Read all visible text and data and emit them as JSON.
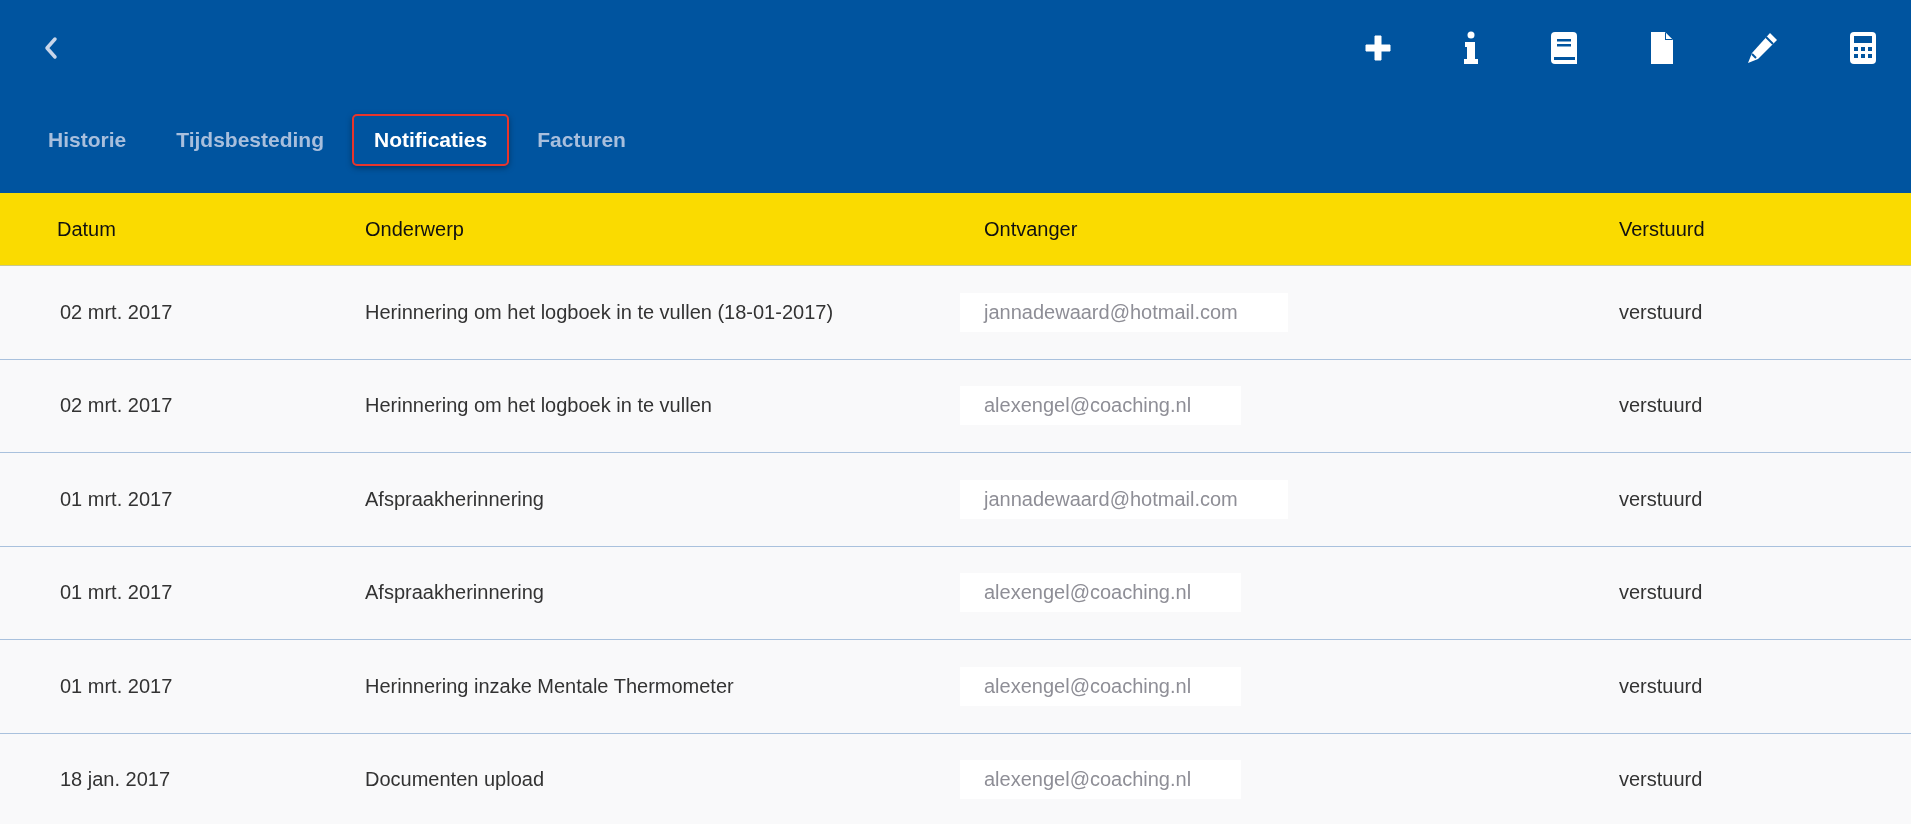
{
  "header": {
    "tabs": [
      {
        "label": "Historie",
        "selected": false
      },
      {
        "label": "Tijdsbesteding",
        "selected": false
      },
      {
        "label": "Notificaties",
        "selected": true
      },
      {
        "label": "Facturen",
        "selected": false
      }
    ]
  },
  "table": {
    "columns": [
      "Datum",
      "Onderwerp",
      "Ontvanger",
      "Verstuurd"
    ],
    "rows": [
      {
        "date": "02 mrt. 2017",
        "subject": "Herinnering om het logboek in te vullen (18-01-2017)",
        "recipient": "jannadewaard@hotmail.com",
        "status": "verstuurd"
      },
      {
        "date": "02 mrt. 2017",
        "subject": "Herinnering om het logboek in te vullen",
        "recipient": "alexengel@coaching.nl",
        "status": "verstuurd"
      },
      {
        "date": "01 mrt. 2017",
        "subject": "Afspraakherinnering",
        "recipient": "jannadewaard@hotmail.com",
        "status": "verstuurd"
      },
      {
        "date": "01 mrt. 2017",
        "subject": "Afspraakherinnering",
        "recipient": "alexengel@coaching.nl",
        "status": "verstuurd"
      },
      {
        "date": "01 mrt. 2017",
        "subject": "Herinnering inzake Mentale Thermometer",
        "recipient": "alexengel@coaching.nl",
        "status": "verstuurd"
      },
      {
        "date": "18 jan. 2017",
        "subject": "Documenten upload",
        "recipient": "alexengel@coaching.nl",
        "status": "verstuurd"
      }
    ]
  }
}
